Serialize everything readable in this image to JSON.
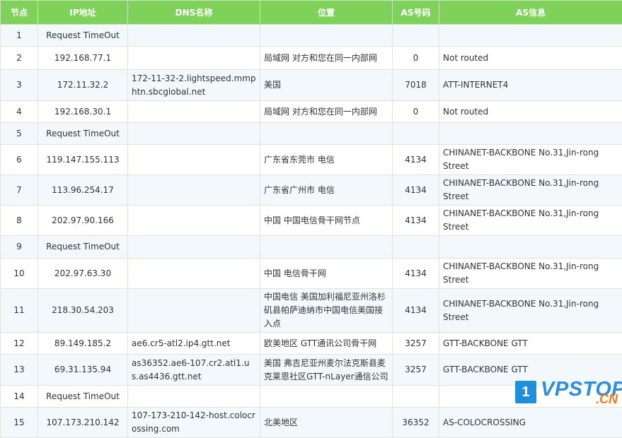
{
  "headers": {
    "node": "节点",
    "ip": "IP地址",
    "dns": "DNS名称",
    "location": "位置",
    "as_num": "AS号码",
    "as_info": "AS信息"
  },
  "rows": [
    {
      "node": "1",
      "ip": "Request TimeOut",
      "dns": "",
      "location": "",
      "as_num": "",
      "as_info": ""
    },
    {
      "node": "2",
      "ip": "192.168.77.1",
      "dns": "",
      "location": "局域网 对方和您在同一内部网",
      "as_num": "0",
      "as_info": "Not routed"
    },
    {
      "node": "3",
      "ip": "172.11.32.2",
      "dns": "172-11-32-2.lightspeed.mmphtn.sbcglobal.net",
      "location": "美国",
      "as_num": "7018",
      "as_info": "ATT-INTERNET4"
    },
    {
      "node": "4",
      "ip": "192.168.30.1",
      "dns": "",
      "location": "局域网 对方和您在同一内部网",
      "as_num": "0",
      "as_info": "Not routed"
    },
    {
      "node": "5",
      "ip": "Request TimeOut",
      "dns": "",
      "location": "",
      "as_num": "",
      "as_info": ""
    },
    {
      "node": "6",
      "ip": "119.147.155.113",
      "dns": "",
      "location": "广东省东莞市 电信",
      "as_num": "4134",
      "as_info": "CHINANET-BACKBONE No.31,Jin-rong Street"
    },
    {
      "node": "7",
      "ip": "113.96.254.17",
      "dns": "",
      "location": "广东省广州市 电信",
      "as_num": "4134",
      "as_info": "CHINANET-BACKBONE No.31,Jin-rong Street"
    },
    {
      "node": "8",
      "ip": "202.97.90.166",
      "dns": "",
      "location": "中国 中国电信骨干网节点",
      "as_num": "4134",
      "as_info": "CHINANET-BACKBONE No.31,Jin-rong Street"
    },
    {
      "node": "9",
      "ip": "Request TimeOut",
      "dns": "",
      "location": "",
      "as_num": "",
      "as_info": ""
    },
    {
      "node": "10",
      "ip": "202.97.63.30",
      "dns": "",
      "location": "中国 电信骨干网",
      "as_num": "4134",
      "as_info": "CHINANET-BACKBONE No.31,Jin-rong Street"
    },
    {
      "node": "11",
      "ip": "218.30.54.203",
      "dns": "",
      "location": "中国电信 美国加利福尼亚州洛杉矶县帕萨迪纳市中国电信美国接入点",
      "as_num": "4134",
      "as_info": "CHINANET-BACKBONE No.31,Jin-rong Street"
    },
    {
      "node": "12",
      "ip": "89.149.185.2",
      "dns": "ae6.cr5-atl2.ip4.gtt.net",
      "location": "欧美地区 GTT通讯公司骨干网",
      "as_num": "3257",
      "as_info": "GTT-BACKBONE GTT"
    },
    {
      "node": "13",
      "ip": "69.31.135.94",
      "dns": "as36352.ae6-107.cr2.atl1.us.as4436.gtt.net",
      "location": "美国 弗吉尼亚州麦尔法克斯县麦克莱恩社区GTT-nLayer通信公司",
      "as_num": "3257",
      "as_info": "GTT-BACKBONE GTT"
    },
    {
      "node": "14",
      "ip": "Request TimeOut",
      "dns": "",
      "location": "",
      "as_num": "",
      "as_info": ""
    },
    {
      "node": "15",
      "ip": "107.173.210.142",
      "dns": "107-173-210-142-host.colocrossing.com",
      "location": "北美地区",
      "as_num": "36352",
      "as_info": "AS-COLOCROSSING"
    }
  ],
  "watermark": {
    "num": "1",
    "brand": "VPSTOP",
    "tld": ".CN"
  }
}
